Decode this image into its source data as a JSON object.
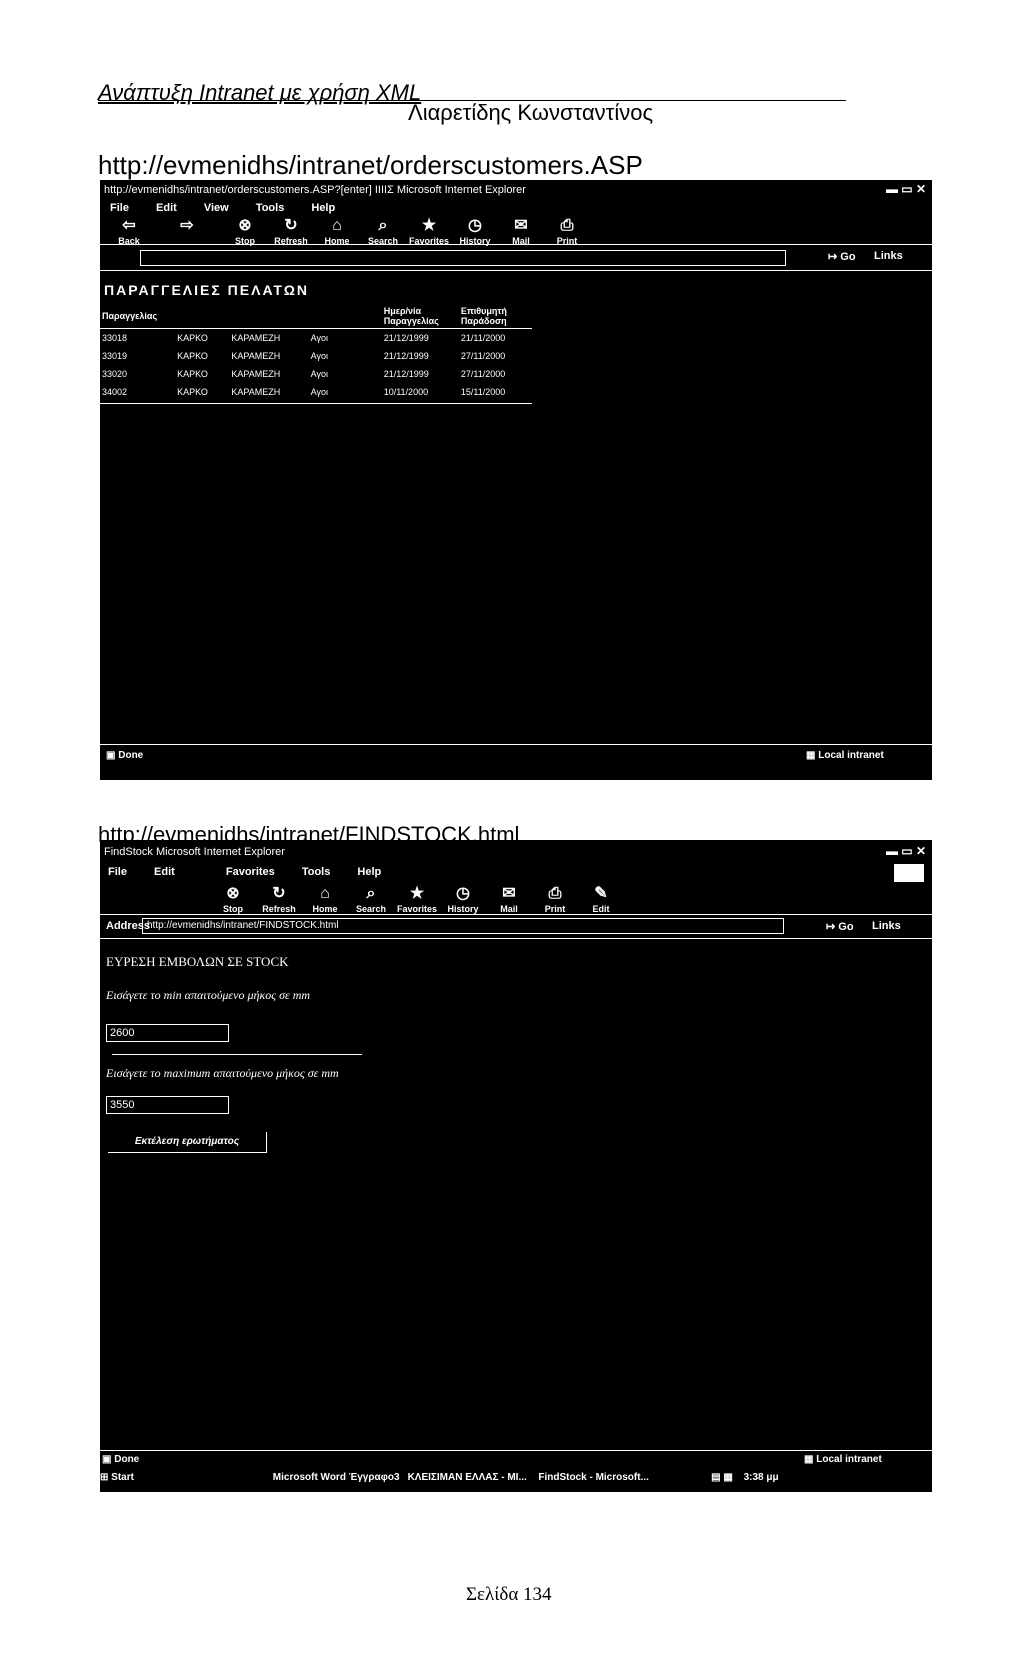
{
  "header": {
    "title": "Ανάπτυξη Intranet με χρήση XML",
    "author": "Λιαρετίδης Κωνσταντίνος"
  },
  "shot1": {
    "url_caption": "http://evmenidhs/intranet/orderscustomers.ASP",
    "window_title": "http://evmenidhs/intranet/orderscustomers.ASP?[enter] ΙΙΙΙΣ Microsoft Internet Explorer",
    "menu": [
      "File",
      "Edit",
      "View",
      "Tools",
      "Help"
    ],
    "toolbar": [
      "Back",
      "Stop",
      "Refresh",
      "Home",
      "Search",
      "Favorites",
      "History",
      "Mail",
      "Print"
    ],
    "go": "Go",
    "links": "Links",
    "page_heading": "ΠΑΡΑΓΓΕΛΙΕΣ ΠΕΛΑΤΩΝ",
    "table": {
      "headers": [
        "Παραγγελίας",
        "",
        "",
        "",
        "Ημερ/νία Παραγγελίας",
        "Επιθυμητή Παράδοση"
      ],
      "rows": [
        [
          "33018",
          "ΚΑΡΚΟ",
          "ΚΑΡΑΜΕΖΗ",
          "Αγοι",
          "21/12/1999",
          "21/11/2000"
        ],
        [
          "33019",
          "ΚΑΡΚΟ",
          "ΚΑΡΑΜΕΖΗ",
          "Αγοι",
          "21/12/1999",
          "27/11/2000"
        ],
        [
          "33020",
          "ΚΑΡΚΟ",
          "ΚΑΡΑΜΕΖΗ",
          "Αγοι",
          "21/12/1999",
          "27/11/2000"
        ],
        [
          "34002",
          "ΚΑΡΚΟ",
          "ΚΑΡΑΜΕΖΗ",
          "Αγοι",
          "10/11/2000",
          "15/11/2000"
        ]
      ]
    },
    "status_left": "Done",
    "status_right": "Local intranet"
  },
  "shot2": {
    "url_caption": "http://evmenidhs/intranet/FINDSTOCK.html",
    "window_title": "FindStock Microsoft Internet Explorer",
    "menu": [
      "File",
      "Edit",
      "Favorites",
      "Tools",
      "Help"
    ],
    "toolbar": [
      "Stop",
      "Refresh",
      "Home",
      "Search",
      "Favorites",
      "History",
      "Mail",
      "Print",
      "Edit"
    ],
    "address_label": "Address",
    "address_value": "http://evmenidhs/intranet/FINDSTOCK.html",
    "go": "Go",
    "links": "Links",
    "form_title": "ΕΥΡΕΣΗ ΕΜΒΟΛΩΝ ΣΕ STOCK",
    "min_label": "Εισάγετε το min απαιτούμενο μήκος σε mm",
    "min_value": "2600",
    "max_label": "Εισάγετε το maximum απαιτούμενο μήκος σε mm",
    "max_value": "3550",
    "submit": "Εκτέλεση ερωτήματος",
    "status_left": "Done",
    "status_right": "Local intranet",
    "taskbar": {
      "start": "Start",
      "items": [
        "Microsoft Word Έγγραφο3",
        "ΚΛΕΙΣΙΜΑΝ ΕΛΛΑΣ - ΜΙ...",
        "FindStock - Microsoft..."
      ],
      "clock": "3:38 μμ"
    }
  },
  "footer": {
    "page": "Σελίδα 134"
  }
}
